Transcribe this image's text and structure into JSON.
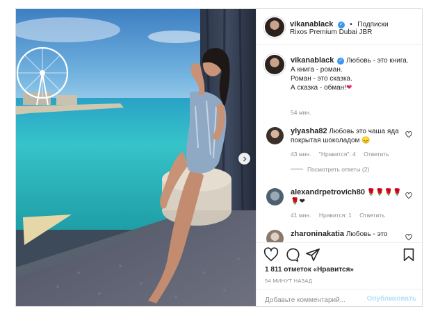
{
  "post": {
    "header": {
      "username": "vikanablack",
      "separator": "•",
      "follow_label": "Подписки",
      "location": "Rixos Premium Dubai JBR"
    },
    "caption": {
      "username": "vikanablack",
      "lines": [
        "Любовь - это книга.",
        "А книга - роман.",
        "Роман - это сказка.",
        "А сказка - обман!"
      ],
      "heart_emoji": "❤",
      "time": "54 мин."
    },
    "comments": [
      {
        "username": "ylyasha82",
        "text": "Любовь это чаша яда покрытая шоколадом",
        "emoji": "😞",
        "time": "43 мин.",
        "likes": "\"Нравится\": 4",
        "reply": "Ответить",
        "view_replies": "Посмотреть ответы (2)"
      },
      {
        "username": "alexandrpetrovich80",
        "text": "🌹🌹🌹🌹",
        "text2": "🌹❤",
        "time": "41 мин.",
        "likes": "Нравится: 1",
        "reply": "Ответить"
      },
      {
        "username": "zharoninakatia",
        "text": "Любовь - это"
      }
    ],
    "likes": {
      "count": "1 811",
      "label": "отметок «Нравится»"
    },
    "time_ago": "54 МИНУТ НАЗАД",
    "add_comment": {
      "placeholder": "Добавьте комментарий...",
      "publish": "Опубликовать"
    },
    "icons": {
      "like": "heart-icon",
      "comment": "comment-icon",
      "share": "share-icon",
      "save": "bookmark-icon",
      "next": "chevron-right-icon",
      "verified": "verified-badge-icon"
    },
    "colors": {
      "verified": "#3897f0",
      "publish": "#b2dffc",
      "muted": "#8e8e8e",
      "border": "#dbdbdb"
    }
  }
}
